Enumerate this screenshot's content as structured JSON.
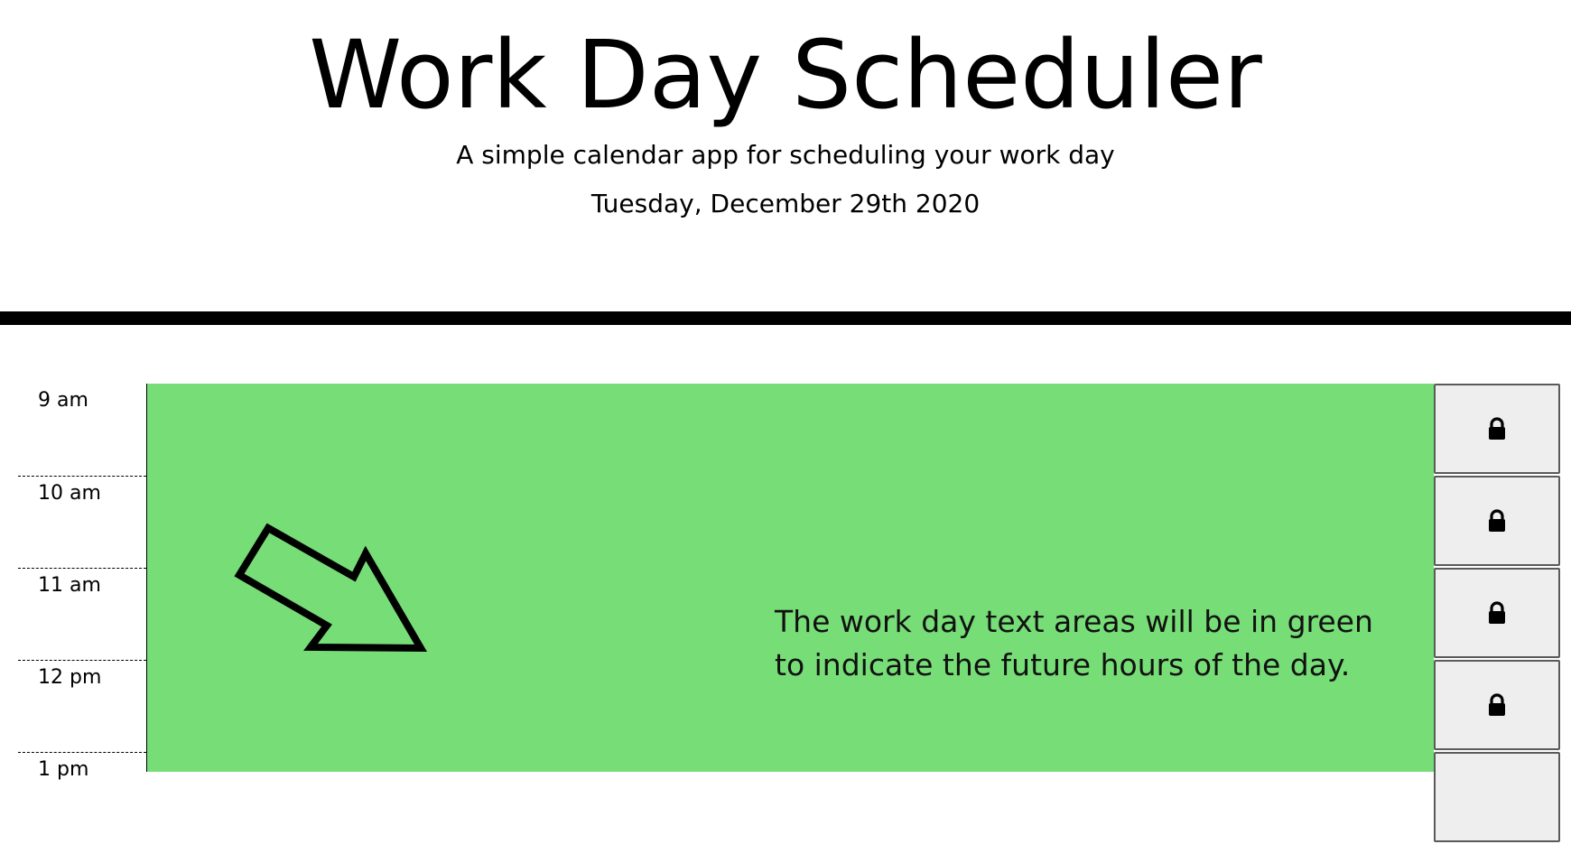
{
  "header": {
    "title": "Work Day Scheduler",
    "subtitle": "A simple calendar app for scheduling your work day",
    "current_day": "Tuesday, December 29th 2020"
  },
  "schedule": {
    "hours": [
      "9 am",
      "10 am",
      "11 am",
      "12 pm",
      "1 pm"
    ],
    "textarea_color": "#77dd77",
    "info_line_1": "The work day text areas will be in green",
    "info_line_2": "to indicate the future hours of the day.",
    "save_icon": "lock-icon"
  }
}
